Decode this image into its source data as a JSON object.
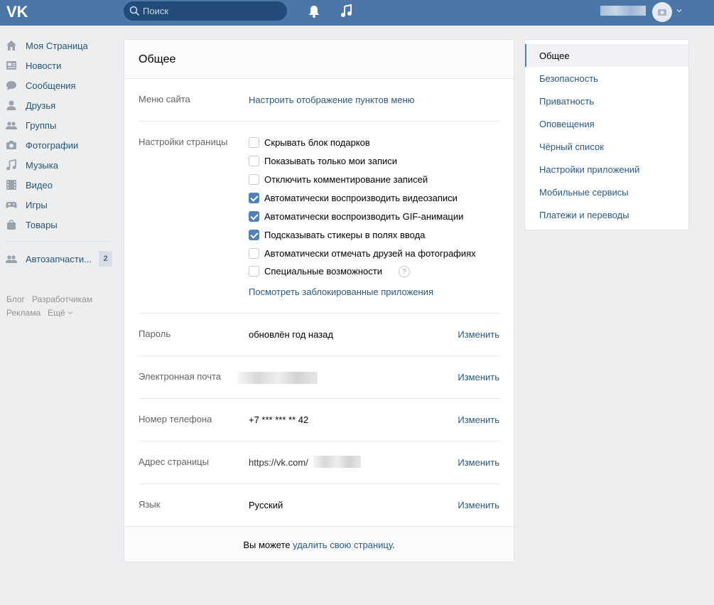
{
  "colors": {
    "header": "#4a76a8",
    "link": "#2a5885",
    "nav_link": "#285473",
    "accent": "#5181b8",
    "bg": "#edeef0"
  },
  "header": {
    "search_placeholder": "Поиск",
    "logo_icon": "vk-logo-icon",
    "notifications_icon": "bell-icon",
    "music_icon": "music-note-icon"
  },
  "leftnav": {
    "items": [
      {
        "label": "Моя Страница",
        "icon": "home-icon"
      },
      {
        "label": "Новости",
        "icon": "news-icon"
      },
      {
        "label": "Сообщения",
        "icon": "messages-icon"
      },
      {
        "label": "Друзья",
        "icon": "user-icon"
      },
      {
        "label": "Группы",
        "icon": "groups-icon"
      },
      {
        "label": "Фотографии",
        "icon": "camera-icon"
      },
      {
        "label": "Музыка",
        "icon": "music-icon"
      },
      {
        "label": "Видео",
        "icon": "video-icon"
      },
      {
        "label": "Игры",
        "icon": "gamepad-icon"
      },
      {
        "label": "Товары",
        "icon": "bag-icon"
      }
    ],
    "group": {
      "label": "Автозапчасти...",
      "badge": "2",
      "icon": "groups-icon"
    },
    "footer": {
      "blog": "Блог",
      "dev": "Разработчикам",
      "ads": "Реклама",
      "more": "Ещё"
    }
  },
  "main": {
    "title": "Общее",
    "menu": {
      "label": "Меню сайта",
      "link": "Настроить отображение пунктов меню"
    },
    "page_settings": {
      "label": "Настройки страницы",
      "options": [
        {
          "label": "Скрывать блок подарков",
          "checked": false
        },
        {
          "label": "Показывать только мои записи",
          "checked": false
        },
        {
          "label": "Отключить комментирование записей",
          "checked": false
        },
        {
          "label": "Автоматически воспроизводить видеозаписи",
          "checked": true
        },
        {
          "label": "Автоматически воспроизводить GIF-анимации",
          "checked": true
        },
        {
          "label": "Подсказывать стикеры в полях ввода",
          "checked": true
        },
        {
          "label": "Автоматически отмечать друзей на фотографиях",
          "checked": false
        },
        {
          "label": "Специальные возможности",
          "checked": false
        }
      ],
      "help": "?",
      "blocked_apps_link": "Посмотреть заблокированные приложения"
    },
    "password": {
      "label": "Пароль",
      "value": "обновлён год назад",
      "action": "Изменить"
    },
    "email": {
      "label": "Электронная почта",
      "action": "Изменить"
    },
    "phone": {
      "label": "Номер телефона",
      "value": "+7 *** *** ** 42",
      "action": "Изменить"
    },
    "address": {
      "label": "Адрес страницы",
      "value": "https://vk.com/",
      "action": "Изменить"
    },
    "language": {
      "label": "Язык",
      "value": "Русский",
      "action": "Изменить"
    },
    "footer": {
      "prefix": "Вы можете ",
      "link": "удалить свою страницу",
      "suffix": "."
    }
  },
  "rightmenu": {
    "items": [
      {
        "label": "Общее",
        "active": true
      },
      {
        "label": "Безопасность"
      },
      {
        "label": "Приватность"
      },
      {
        "label": "Оповещения"
      },
      {
        "label": "Чёрный список"
      },
      {
        "label": "Настройки приложений"
      },
      {
        "label": "Мобильные сервисы"
      },
      {
        "label": "Платежи и переводы"
      }
    ]
  }
}
